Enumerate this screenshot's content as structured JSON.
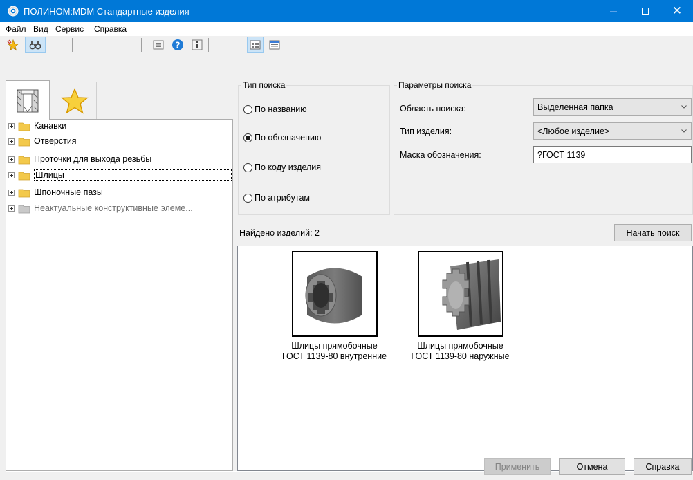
{
  "window": {
    "title": "ПОЛИНОМ:MDM Стандартные изделия",
    "icon": "gear-icon"
  },
  "menu": [
    "Файл",
    "Вид",
    "Сервис",
    "Справка"
  ],
  "toolbar": {
    "buttons": [
      "favorite-star-icon",
      "binoculars-icon",
      "list-icon",
      "help-icon",
      "info-icon",
      "large-icons-view-icon",
      "details-view-icon"
    ]
  },
  "left_tabs": [
    "catalog-tab",
    "favorites-tab"
  ],
  "tree": [
    {
      "label": "Канавки",
      "active": true
    },
    {
      "label": "Отверстия",
      "active": true
    },
    {
      "label": "Проточки для выхода резьбы",
      "active": true
    },
    {
      "label": "Шлицы",
      "active": true,
      "selected": true
    },
    {
      "label": "Шпоночные пазы",
      "active": true
    },
    {
      "label": "Неактуальные конструктивные элеме...",
      "active": false
    }
  ],
  "search_type": {
    "legend": "Тип поиска",
    "options": [
      "По названию",
      "По обозначению",
      "По коду изделия",
      "По атрибутам"
    ],
    "selected": "По обозначению"
  },
  "search_params": {
    "legend": "Параметры поиска",
    "area_label": "Область поиска:",
    "area_value": "Выделенная папка",
    "type_label": "Тип изделия:",
    "type_value": "<Любое изделие>",
    "mask_label": "Маска обозначения:",
    "mask_value": "?ГОСТ 1139"
  },
  "results": {
    "found_text": "Найдено изделий: 2",
    "start_button": "Начать поиск",
    "items": [
      {
        "line1": "Шлицы прямобочные",
        "line2": "ГОСТ 1139-80 внутренние"
      },
      {
        "line1": "Шлицы прямобочные",
        "line2": "ГОСТ 1139-80 наружные"
      }
    ]
  },
  "footer": {
    "apply": "Применить",
    "cancel": "Отмена",
    "help": "Справка"
  },
  "colors": {
    "titlebar": "#0078d7",
    "folder": "#f3c94b"
  }
}
